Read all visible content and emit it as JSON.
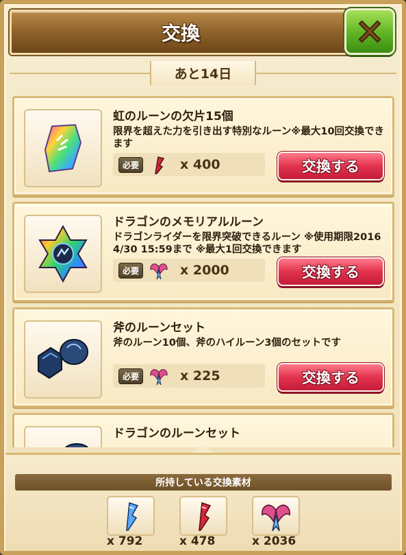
{
  "header": {
    "title": "交換",
    "close_icon": "close-x-icon"
  },
  "days_remaining": "あと14日",
  "require_label": "必要",
  "exchange_button_label": "交換する",
  "items": [
    {
      "title": "虹のルーンの欠片15個",
      "description": "限界を超えた力を引き出す特別なルーン※最大10回交換できます",
      "icon": "rainbow-rune-shard-icon",
      "cost_icon": "red-feather-icon",
      "cost": "x 400"
    },
    {
      "title": "ドラゴンのメモリアルルーン",
      "description": "ドラゴンライダーを限界突破できるルーン ※使用期限2016 4/30 15:59まで ※最大1回交換できます",
      "icon": "rainbow-star-rune-icon",
      "cost_icon": "dragon-wings-icon",
      "cost": "x 2000"
    },
    {
      "title": "斧のルーンセット",
      "description": "斧のルーン10個、斧のハイルーン3個のセットです",
      "icon": "axe-rune-set-icon",
      "cost_icon": "dragon-wings-icon",
      "cost": "x 225"
    },
    {
      "title": "ドラゴンのルーンセット",
      "description": "",
      "icon": "dragon-rune-set-icon",
      "cost_icon": "",
      "cost": ""
    }
  ],
  "footer": {
    "label": "所持している交換素材",
    "materials": [
      {
        "icon": "blue-feather-icon",
        "count": "x 792"
      },
      {
        "icon": "red-feather-icon",
        "count": "x 478"
      },
      {
        "icon": "dragon-wings-icon",
        "count": "x 2036"
      }
    ]
  },
  "colors": {
    "header_brown": "#8a5e27",
    "close_green": "#5fb323",
    "exchange_red": "#e2334e",
    "card_bg": "#fff6dc",
    "card_border": "#d9b874"
  }
}
